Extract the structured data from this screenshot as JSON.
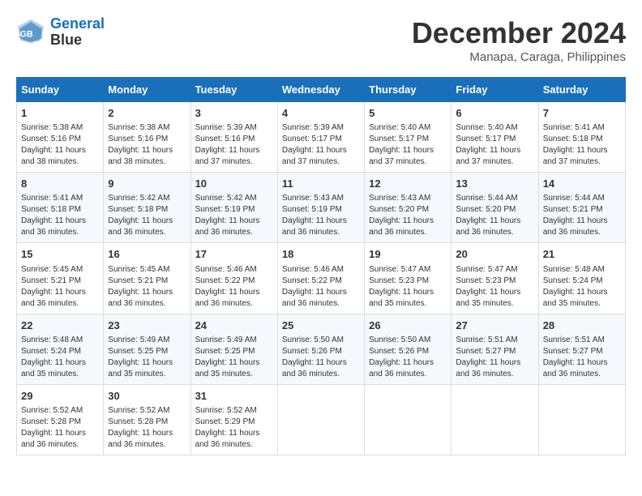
{
  "header": {
    "logo_line1": "General",
    "logo_line2": "Blue",
    "month": "December 2024",
    "location": "Manapa, Caraga, Philippines"
  },
  "weekdays": [
    "Sunday",
    "Monday",
    "Tuesday",
    "Wednesday",
    "Thursday",
    "Friday",
    "Saturday"
  ],
  "weeks": [
    [
      {
        "day": "1",
        "info": "Sunrise: 5:38 AM\nSunset: 5:16 PM\nDaylight: 11 hours\nand 38 minutes."
      },
      {
        "day": "2",
        "info": "Sunrise: 5:38 AM\nSunset: 5:16 PM\nDaylight: 11 hours\nand 38 minutes."
      },
      {
        "day": "3",
        "info": "Sunrise: 5:39 AM\nSunset: 5:16 PM\nDaylight: 11 hours\nand 37 minutes."
      },
      {
        "day": "4",
        "info": "Sunrise: 5:39 AM\nSunset: 5:17 PM\nDaylight: 11 hours\nand 37 minutes."
      },
      {
        "day": "5",
        "info": "Sunrise: 5:40 AM\nSunset: 5:17 PM\nDaylight: 11 hours\nand 37 minutes."
      },
      {
        "day": "6",
        "info": "Sunrise: 5:40 AM\nSunset: 5:17 PM\nDaylight: 11 hours\nand 37 minutes."
      },
      {
        "day": "7",
        "info": "Sunrise: 5:41 AM\nSunset: 5:18 PM\nDaylight: 11 hours\nand 37 minutes."
      }
    ],
    [
      {
        "day": "8",
        "info": "Sunrise: 5:41 AM\nSunset: 5:18 PM\nDaylight: 11 hours\nand 36 minutes."
      },
      {
        "day": "9",
        "info": "Sunrise: 5:42 AM\nSunset: 5:18 PM\nDaylight: 11 hours\nand 36 minutes."
      },
      {
        "day": "10",
        "info": "Sunrise: 5:42 AM\nSunset: 5:19 PM\nDaylight: 11 hours\nand 36 minutes."
      },
      {
        "day": "11",
        "info": "Sunrise: 5:43 AM\nSunset: 5:19 PM\nDaylight: 11 hours\nand 36 minutes."
      },
      {
        "day": "12",
        "info": "Sunrise: 5:43 AM\nSunset: 5:20 PM\nDaylight: 11 hours\nand 36 minutes."
      },
      {
        "day": "13",
        "info": "Sunrise: 5:44 AM\nSunset: 5:20 PM\nDaylight: 11 hours\nand 36 minutes."
      },
      {
        "day": "14",
        "info": "Sunrise: 5:44 AM\nSunset: 5:21 PM\nDaylight: 11 hours\nand 36 minutes."
      }
    ],
    [
      {
        "day": "15",
        "info": "Sunrise: 5:45 AM\nSunset: 5:21 PM\nDaylight: 11 hours\nand 36 minutes."
      },
      {
        "day": "16",
        "info": "Sunrise: 5:45 AM\nSunset: 5:21 PM\nDaylight: 11 hours\nand 36 minutes."
      },
      {
        "day": "17",
        "info": "Sunrise: 5:46 AM\nSunset: 5:22 PM\nDaylight: 11 hours\nand 36 minutes."
      },
      {
        "day": "18",
        "info": "Sunrise: 5:46 AM\nSunset: 5:22 PM\nDaylight: 11 hours\nand 36 minutes."
      },
      {
        "day": "19",
        "info": "Sunrise: 5:47 AM\nSunset: 5:23 PM\nDaylight: 11 hours\nand 35 minutes."
      },
      {
        "day": "20",
        "info": "Sunrise: 5:47 AM\nSunset: 5:23 PM\nDaylight: 11 hours\nand 35 minutes."
      },
      {
        "day": "21",
        "info": "Sunrise: 5:48 AM\nSunset: 5:24 PM\nDaylight: 11 hours\nand 35 minutes."
      }
    ],
    [
      {
        "day": "22",
        "info": "Sunrise: 5:48 AM\nSunset: 5:24 PM\nDaylight: 11 hours\nand 35 minutes."
      },
      {
        "day": "23",
        "info": "Sunrise: 5:49 AM\nSunset: 5:25 PM\nDaylight: 11 hours\nand 35 minutes."
      },
      {
        "day": "24",
        "info": "Sunrise: 5:49 AM\nSunset: 5:25 PM\nDaylight: 11 hours\nand 35 minutes."
      },
      {
        "day": "25",
        "info": "Sunrise: 5:50 AM\nSunset: 5:26 PM\nDaylight: 11 hours\nand 36 minutes."
      },
      {
        "day": "26",
        "info": "Sunrise: 5:50 AM\nSunset: 5:26 PM\nDaylight: 11 hours\nand 36 minutes."
      },
      {
        "day": "27",
        "info": "Sunrise: 5:51 AM\nSunset: 5:27 PM\nDaylight: 11 hours\nand 36 minutes."
      },
      {
        "day": "28",
        "info": "Sunrise: 5:51 AM\nSunset: 5:27 PM\nDaylight: 11 hours\nand 36 minutes."
      }
    ],
    [
      {
        "day": "29",
        "info": "Sunrise: 5:52 AM\nSunset: 5:28 PM\nDaylight: 11 hours\nand 36 minutes."
      },
      {
        "day": "30",
        "info": "Sunrise: 5:52 AM\nSunset: 5:28 PM\nDaylight: 11 hours\nand 36 minutes."
      },
      {
        "day": "31",
        "info": "Sunrise: 5:52 AM\nSunset: 5:29 PM\nDaylight: 11 hours\nand 36 minutes."
      },
      {
        "day": "",
        "info": ""
      },
      {
        "day": "",
        "info": ""
      },
      {
        "day": "",
        "info": ""
      },
      {
        "day": "",
        "info": ""
      }
    ]
  ]
}
